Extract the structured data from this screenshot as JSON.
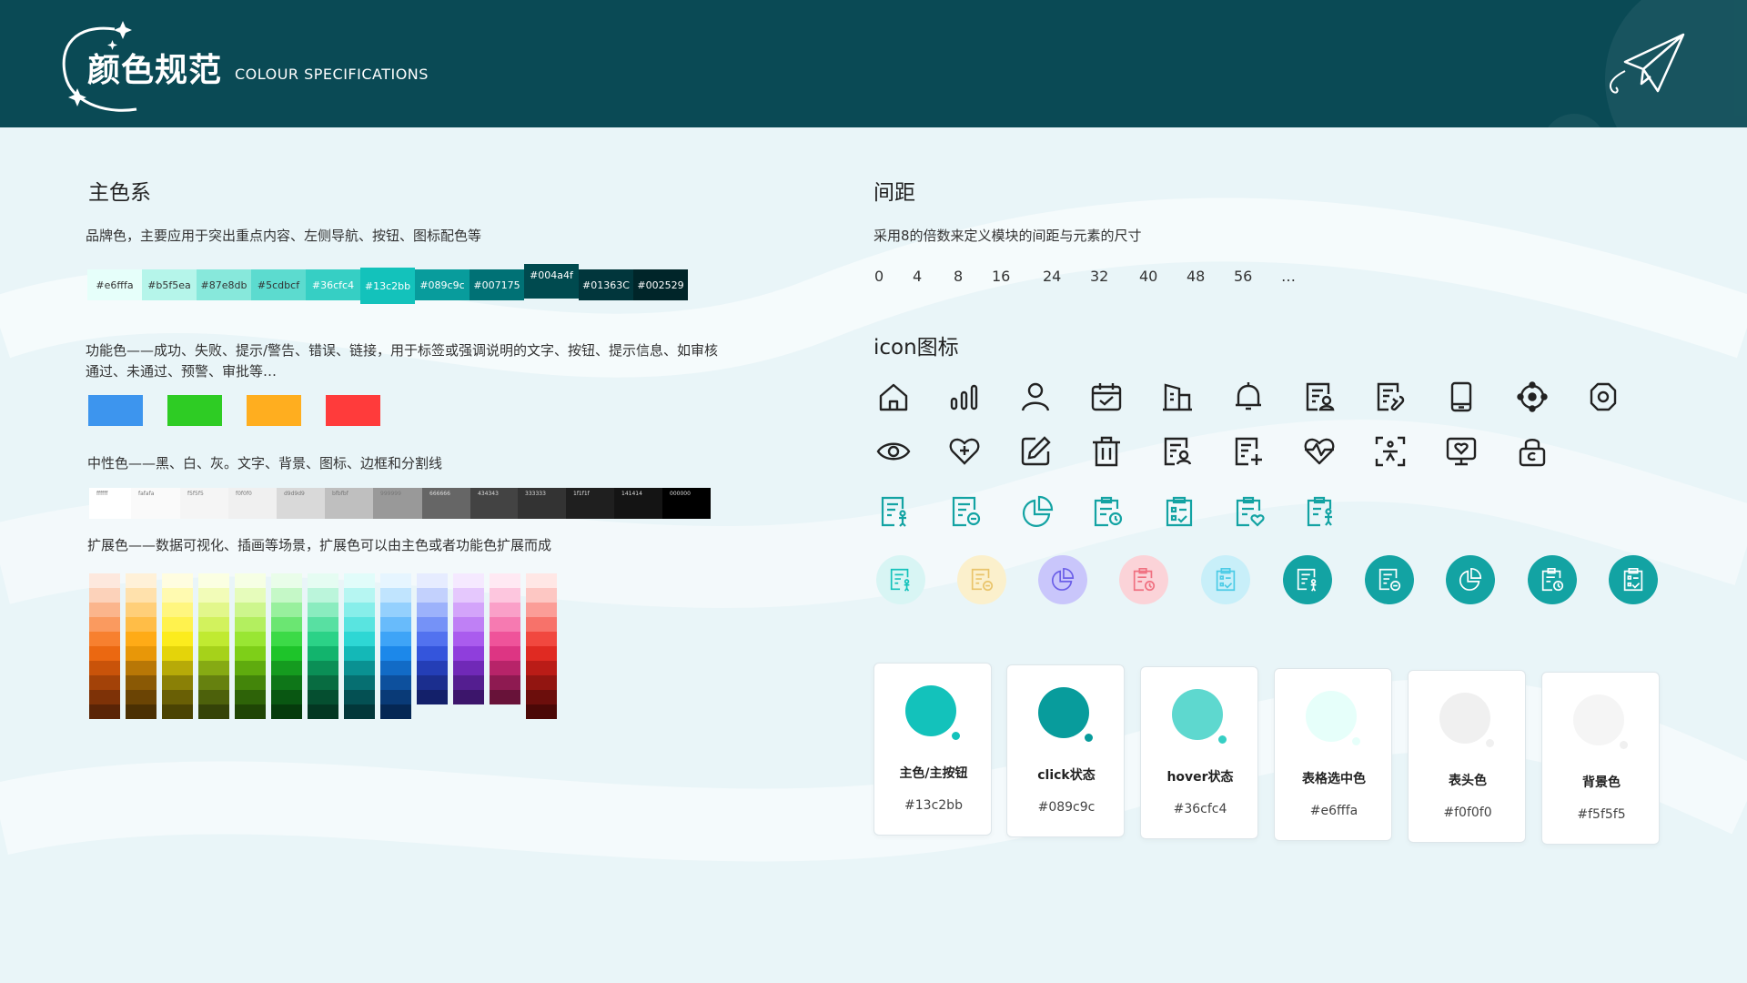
{
  "header": {
    "title": "颜色规范",
    "subtitle": "COLOUR SPECIFICATIONS",
    "bg_color": "#0a4a55",
    "deco_icon": "paper-plane-icon"
  },
  "primary": {
    "title": "主色系",
    "desc": "品牌色，主要应用于突出重点内容、左侧导航、按钮、图标配色等",
    "swatches": [
      {
        "label": "#e6fffa",
        "color": "#e6fffa"
      },
      {
        "label": "#b5f5ea",
        "color": "#b5f5ea"
      },
      {
        "label": "#87e8db",
        "color": "#87e8db"
      },
      {
        "label": "#5cdbcf",
        "color": "#5cdbcf"
      },
      {
        "label": "#36cfc4",
        "color": "#36cfc4"
      },
      {
        "label": "#13c2bb",
        "color": "#13c2bb"
      },
      {
        "label": "#089c9c",
        "color": "#089c9c"
      },
      {
        "label": "#007175",
        "color": "#007175"
      },
      {
        "label": "#004a4f",
        "color": "#004a4f"
      },
      {
        "label": "#01363C",
        "color": "#01363c"
      },
      {
        "label": "#002529",
        "color": "#002529"
      }
    ]
  },
  "functional": {
    "desc": "功能色——成功、失败、提示/警告、错误、链接，用于标签或强调说明的文字、按钮、提示信息、如审核通过、未通过、预警、审批等…",
    "colors": [
      "#3d95ee",
      "#2ecc24",
      "#ffae1f",
      "#ff3b3b"
    ]
  },
  "neutral": {
    "desc": "中性色——黑、白、灰。文字、背景、图标、边框和分割线",
    "swatches": [
      {
        "label": "ffffff",
        "color": "#ffffff"
      },
      {
        "label": "fafafa",
        "color": "#fafafa"
      },
      {
        "label": "f5f5f5",
        "color": "#f5f5f5"
      },
      {
        "label": "f0f0f0",
        "color": "#f0f0f0"
      },
      {
        "label": "d9d9d9",
        "color": "#d9d9d9"
      },
      {
        "label": "bfbfbf",
        "color": "#bfbfbf"
      },
      {
        "label": "999999",
        "color": "#999999"
      },
      {
        "label": "666666",
        "color": "#666666"
      },
      {
        "label": "434343",
        "color": "#434343"
      },
      {
        "label": "333333",
        "color": "#333333"
      },
      {
        "label": "1f1f1f",
        "color": "#1f1f1f"
      },
      {
        "label": "141414",
        "color": "#141414"
      },
      {
        "label": "000000",
        "color": "#000000"
      }
    ]
  },
  "extended": {
    "desc": "扩展色——数据可视化、插画等场景，扩展色可以由主色或者功能色扩展而成",
    "columns": [
      [
        "#fde8dd",
        "#fcd2ba",
        "#fbb58c",
        "#fa9a5f",
        "#f7802f",
        "#eb6811",
        "#c9530a",
        "#a34208",
        "#7e3207",
        "#5a2406"
      ],
      [
        "#fff1d8",
        "#ffe1ac",
        "#ffcf79",
        "#ffbd47",
        "#ffab16",
        "#e89708",
        "#b87706",
        "#8a5905",
        "#6b4404",
        "#4b3003"
      ],
      [
        "#fffde0",
        "#fffab0",
        "#fff67f",
        "#fff24e",
        "#fcec1d",
        "#e4d40a",
        "#b7aa08",
        "#8a8006",
        "#695f05",
        "#4a4303"
      ],
      [
        "#fbffe2",
        "#f2fcb8",
        "#e2f78b",
        "#d2f25d",
        "#c0ea31",
        "#a6d21a",
        "#86aa13",
        "#66810f",
        "#4d610b",
        "#354308"
      ],
      [
        "#f6ffe4",
        "#e6fcbb",
        "#cdf68d",
        "#b3ef5f",
        "#99e633",
        "#7ecf18",
        "#5fab0e",
        "#43850a",
        "#2e6308",
        "#1f4505"
      ],
      [
        "#e9fde9",
        "#c5f8c7",
        "#98f09d",
        "#6be672",
        "#3cda47",
        "#1ec42a",
        "#159b1f",
        "#0e7618",
        "#095712",
        "#053b0c"
      ],
      [
        "#e5fcf2",
        "#bbf5db",
        "#8aecbf",
        "#58e0a2",
        "#2bd287",
        "#12b46d",
        "#0b8f56",
        "#086c41",
        "#054f30",
        "#033722"
      ],
      [
        "#e1fcfa",
        "#b6f6f2",
        "#87eeea",
        "#59e4e0",
        "#2ed7d4",
        "#14b8b7",
        "#0a9192",
        "#066f71",
        "#045053",
        "#02373a"
      ],
      [
        "#e6f5ff",
        "#c0e4fe",
        "#94d0fd",
        "#68bbfb",
        "#3ea4f7",
        "#1c88ea",
        "#126bc6",
        "#0d509d",
        "#093a77",
        "#052754"
      ],
      [
        "#e6ecff",
        "#c3d1fd",
        "#9cb2fb",
        "#7592f7",
        "#5272ef",
        "#3455dc",
        "#243eb6",
        "#1b2e8e",
        "#13206a",
        "#0c154a"
      ],
      [
        "#f5e9ff",
        "#e5c8fd",
        "#d3a4fa",
        "#bf80f5",
        "#aa5cee",
        "#8f3edc",
        "#7029b7",
        "#541e90",
        "#3c156b",
        "#280d4a"
      ],
      [
        "#ffe9f3",
        "#fdc6de",
        "#faa0c8",
        "#f67ab1",
        "#ef539a",
        "#dd3583",
        "#b72469",
        "#8e1a51",
        "#681239",
        "#480b27"
      ],
      [
        "#ffe7e5",
        "#fdc7c3",
        "#fb9d97",
        "#f7726a",
        "#f1483f",
        "#e02a22",
        "#ba1c17",
        "#921511",
        "#6c0e0c",
        "#4b0807"
      ]
    ]
  },
  "spacing": {
    "title": "间距",
    "desc": "采用8的倍数来定义模块的间距与元素的尺寸",
    "values": [
      "0",
      "4",
      "8",
      "16",
      "24",
      "32",
      "40",
      "48",
      "56",
      "…"
    ]
  },
  "icons": {
    "title": "icon图标",
    "row1": [
      "home-icon",
      "bar-chart-icon",
      "user-icon",
      "calendar-check-icon",
      "building-icon",
      "bell-icon",
      "document-user-icon",
      "document-wrench-icon",
      "mobile-icon",
      "target-icon",
      "settings-icon"
    ],
    "row2": [
      "eye-icon",
      "heart-plus-icon",
      "edit-icon",
      "trash-icon",
      "document-search-user-icon",
      "document-add-icon",
      "heartbeat-icon",
      "face-scan-icon",
      "monitor-heart-icon",
      "lock-icon"
    ],
    "row3": [
      "form-person-icon",
      "form-minus-icon",
      "pie-chart-icon",
      "clipboard-clock-icon",
      "clipboard-check-icon",
      "clipboard-heart-icon",
      "clipboard-person-icon"
    ],
    "row4": [
      {
        "name": "form-person-icon",
        "bg": "#d8f5f4",
        "fg": "#13c2bb"
      },
      {
        "name": "form-minus-icon",
        "bg": "#fbf0cc",
        "fg": "#e9c46a"
      },
      {
        "name": "pie-chart-icon",
        "bg": "#c9c6fb",
        "fg": "#6b5fe8"
      },
      {
        "name": "clipboard-clock-icon",
        "bg": "#fbd3d8",
        "fg": "#f07080"
      },
      {
        "name": "clipboard-check-icon",
        "bg": "#c8eff9",
        "fg": "#4ccbe6"
      },
      {
        "name": "form-person-icon",
        "bg": "#13a3a3",
        "fg": "#ffffff"
      },
      {
        "name": "form-minus-icon",
        "bg": "#13a3a3",
        "fg": "#ffffff"
      },
      {
        "name": "pie-chart-icon",
        "bg": "#13a3a3",
        "fg": "#ffffff"
      },
      {
        "name": "clipboard-clock-icon",
        "bg": "#13a3a3",
        "fg": "#ffffff"
      },
      {
        "name": "clipboard-check-icon",
        "bg": "#13a3a3",
        "fg": "#ffffff"
      }
    ]
  },
  "cards": [
    {
      "label": "主色/主按钮",
      "value": "#13c2bb",
      "color": "#13c2bb",
      "accent": "#13c2bb"
    },
    {
      "label": "click状态",
      "value": "#089c9c",
      "color": "#089c9c",
      "accent": "#089c9c"
    },
    {
      "label": "hover状态",
      "value": "#36cfc4",
      "color": "#5ed8cf",
      "accent": "#36cfc4"
    },
    {
      "label": "表格选中色",
      "value": "#e6fffa",
      "color": "#e6fffa",
      "accent": "#e6fffa"
    },
    {
      "label": "表头色",
      "value": "#f0f0f0",
      "color": "#f0f0f0",
      "accent": "#f0f0f0"
    },
    {
      "label": "背景色",
      "value": "#f5f5f5",
      "color": "#f5f5f5",
      "accent": "#f0f0f0"
    }
  ]
}
